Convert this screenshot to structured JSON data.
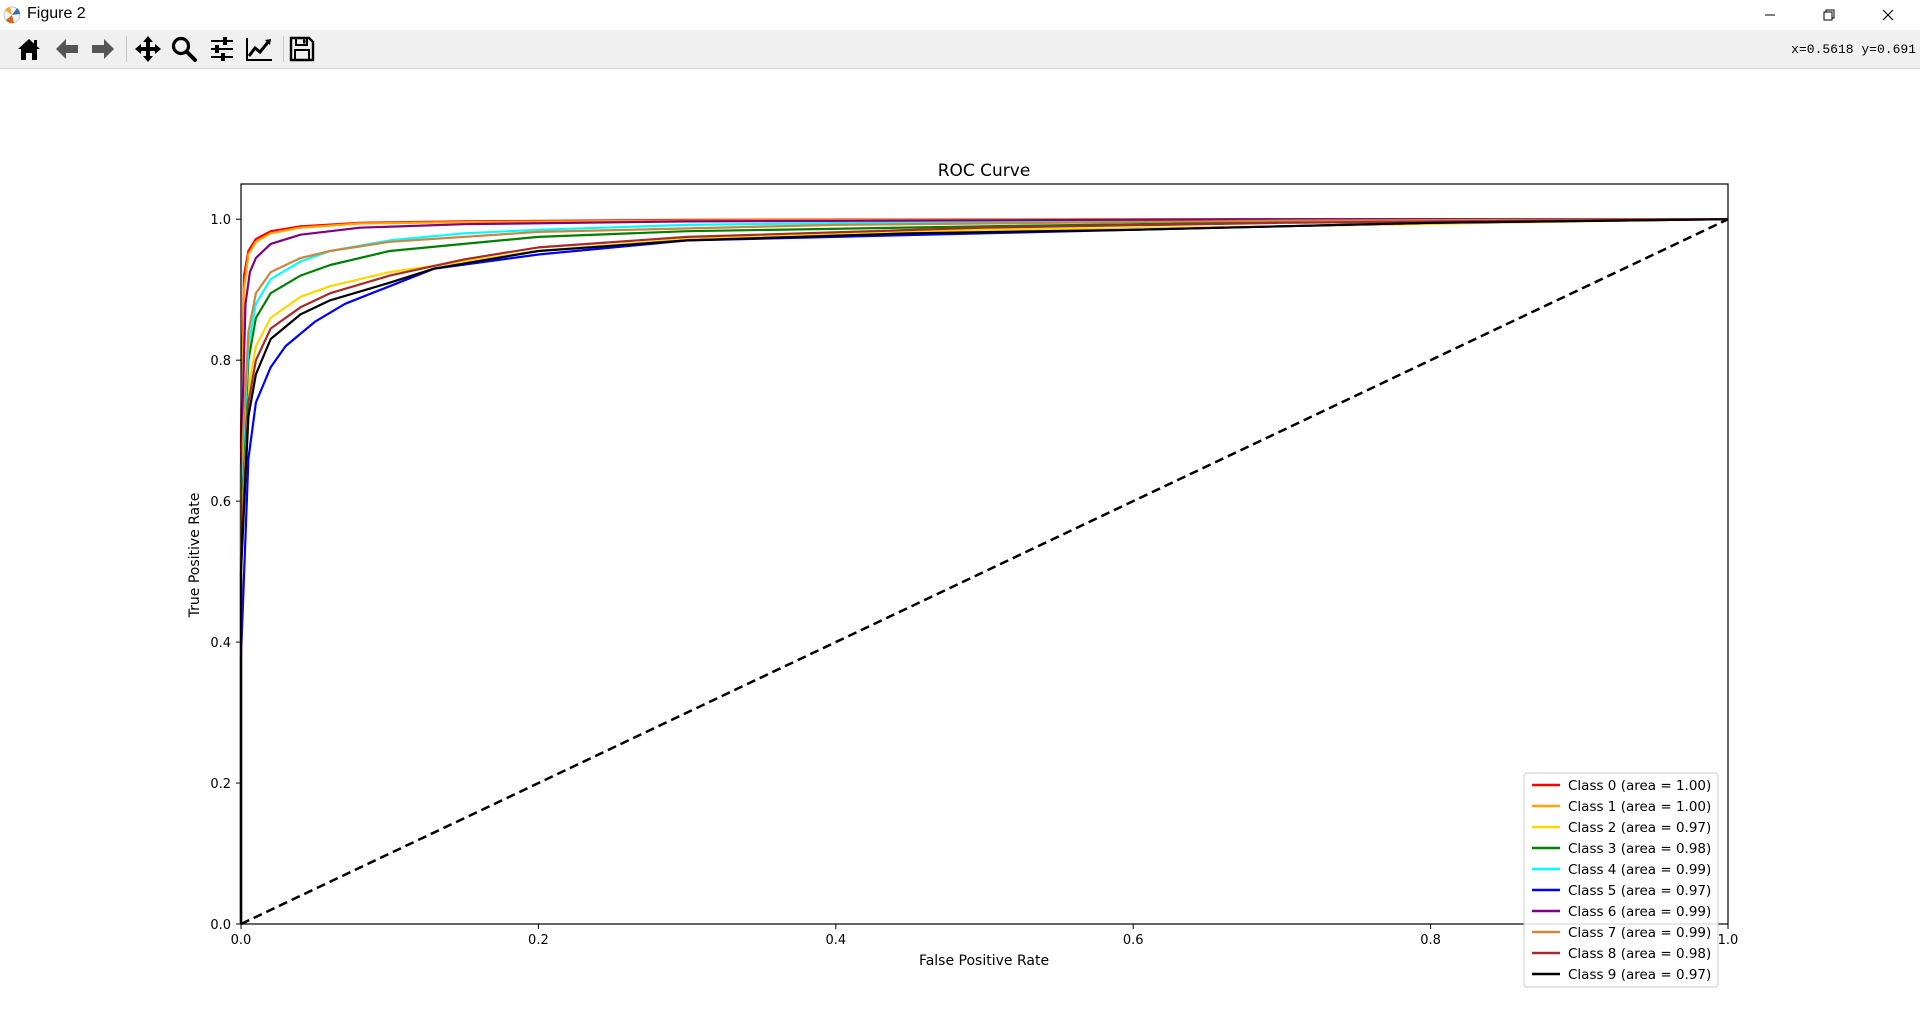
{
  "window": {
    "title": "Figure 2"
  },
  "toolbar": {
    "buttons": [
      {
        "name": "home-button",
        "icon": "home-icon"
      },
      {
        "name": "back-button",
        "icon": "arrow-left-icon"
      },
      {
        "name": "forward-button",
        "icon": "arrow-right-icon"
      },
      {
        "name": "pan-button",
        "icon": "move-icon"
      },
      {
        "name": "zoom-button",
        "icon": "magnifier-icon"
      },
      {
        "name": "configure-subplots-button",
        "icon": "sliders-icon"
      },
      {
        "name": "edit-axis-button",
        "icon": "line-chart-icon"
      },
      {
        "name": "save-button",
        "icon": "floppy-disk-icon"
      }
    ],
    "coords": "x=0.5618  y=0.691"
  },
  "chart_data": {
    "type": "line",
    "title": "ROC Curve",
    "xlabel": "False Positive Rate",
    "ylabel": "True Positive Rate",
    "xlim": [
      0.0,
      1.0
    ],
    "ylim": [
      0.0,
      1.05
    ],
    "xticks": [
      0.0,
      0.2,
      0.4,
      0.6,
      0.8,
      1.0
    ],
    "yticks": [
      0.0,
      0.2,
      0.4,
      0.6,
      0.8,
      1.0
    ],
    "xtick_labels": [
      "0.0",
      "0.2",
      "0.4",
      "0.6",
      "0.8",
      "1.0"
    ],
    "ytick_labels": [
      "0.0",
      "0.2",
      "0.4",
      "0.6",
      "0.8",
      "1.0"
    ],
    "legend_position": "lower-right",
    "grid": false,
    "series": [
      {
        "name": "Class 0 (area = 1.00)",
        "color": "#ff0000",
        "x": [
          0,
          0.0,
          0.002,
          0.005,
          0.01,
          0.02,
          0.04,
          0.08,
          0.15,
          0.3,
          0.6,
          1.0
        ],
        "y": [
          0,
          0.7,
          0.92,
          0.955,
          0.972,
          0.983,
          0.99,
          0.995,
          0.997,
          0.999,
          1.0,
          1.0
        ]
      },
      {
        "name": "Class 1 (area = 1.00)",
        "color": "#ffa500",
        "x": [
          0,
          0.0,
          0.002,
          0.005,
          0.01,
          0.02,
          0.04,
          0.08,
          0.15,
          0.3,
          0.6,
          1.0
        ],
        "y": [
          0,
          0.62,
          0.9,
          0.95,
          0.968,
          0.98,
          0.988,
          0.994,
          0.996,
          0.998,
          1.0,
          1.0
        ]
      },
      {
        "name": "Class 2 (area = 0.97)",
        "color": "#ffd700",
        "x": [
          0,
          0.0,
          0.005,
          0.01,
          0.02,
          0.04,
          0.06,
          0.1,
          0.15,
          0.2,
          0.3,
          0.5,
          0.7,
          0.9,
          1.0
        ],
        "y": [
          0,
          0.55,
          0.76,
          0.82,
          0.86,
          0.89,
          0.905,
          0.925,
          0.94,
          0.955,
          0.972,
          0.985,
          0.99,
          0.997,
          1.0
        ]
      },
      {
        "name": "Class 3 (area = 0.98)",
        "color": "#008000",
        "x": [
          0,
          0.0,
          0.005,
          0.01,
          0.02,
          0.04,
          0.06,
          0.1,
          0.15,
          0.2,
          0.3,
          0.5,
          0.7,
          1.0
        ],
        "y": [
          0,
          0.6,
          0.8,
          0.86,
          0.895,
          0.92,
          0.935,
          0.955,
          0.965,
          0.975,
          0.983,
          0.99,
          0.996,
          1.0
        ]
      },
      {
        "name": "Class 4 (area = 0.99)",
        "color": "#00ffff",
        "x": [
          0,
          0.0,
          0.005,
          0.01,
          0.02,
          0.04,
          0.06,
          0.1,
          0.15,
          0.2,
          0.3,
          0.5,
          1.0
        ],
        "y": [
          0,
          0.62,
          0.82,
          0.88,
          0.915,
          0.94,
          0.955,
          0.97,
          0.98,
          0.985,
          0.992,
          0.997,
          1.0
        ]
      },
      {
        "name": "Class 5 (area = 0.97)",
        "color": "#0000ff",
        "x": [
          0,
          0.0,
          0.005,
          0.01,
          0.02,
          0.03,
          0.05,
          0.07,
          0.1,
          0.13,
          0.2,
          0.3,
          0.5,
          0.7,
          0.8,
          1.0
        ],
        "y": [
          0,
          0.38,
          0.66,
          0.74,
          0.79,
          0.82,
          0.855,
          0.88,
          0.905,
          0.93,
          0.95,
          0.97,
          0.98,
          0.99,
          0.995,
          1.0
        ]
      },
      {
        "name": "Class 6 (area = 0.99)",
        "color": "#800080",
        "x": [
          0,
          0.0,
          0.003,
          0.006,
          0.01,
          0.02,
          0.04,
          0.08,
          0.15,
          0.3,
          0.7,
          1.0
        ],
        "y": [
          0,
          0.65,
          0.88,
          0.925,
          0.945,
          0.965,
          0.978,
          0.988,
          0.993,
          0.997,
          1.0,
          1.0
        ]
      },
      {
        "name": "Class 7 (area = 0.99)",
        "color": "#cd853f",
        "x": [
          0,
          0.0,
          0.005,
          0.01,
          0.02,
          0.04,
          0.06,
          0.1,
          0.2,
          0.4,
          0.7,
          1.0
        ],
        "y": [
          0,
          0.64,
          0.84,
          0.895,
          0.925,
          0.945,
          0.955,
          0.968,
          0.982,
          0.992,
          0.998,
          1.0
        ]
      },
      {
        "name": "Class 8 (area = 0.98)",
        "color": "#a52a2a",
        "x": [
          0,
          0.0,
          0.005,
          0.01,
          0.02,
          0.04,
          0.06,
          0.1,
          0.15,
          0.2,
          0.3,
          0.5,
          0.7,
          1.0
        ],
        "y": [
          0,
          0.52,
          0.74,
          0.8,
          0.845,
          0.875,
          0.895,
          0.92,
          0.943,
          0.96,
          0.975,
          0.988,
          0.995,
          1.0
        ]
      },
      {
        "name": "Class 9 (area = 0.97)",
        "color": "#000000",
        "x": [
          0,
          0.0,
          0.005,
          0.01,
          0.02,
          0.04,
          0.06,
          0.1,
          0.13,
          0.2,
          0.3,
          0.45,
          0.6,
          0.8,
          1.0
        ],
        "y": [
          0,
          0.5,
          0.72,
          0.78,
          0.83,
          0.865,
          0.885,
          0.91,
          0.93,
          0.955,
          0.97,
          0.98,
          0.985,
          0.995,
          1.0
        ]
      }
    ],
    "diagonal": {
      "x": [
        0,
        1
      ],
      "y": [
        0,
        1
      ],
      "color": "#000000",
      "style": "dashed"
    }
  }
}
